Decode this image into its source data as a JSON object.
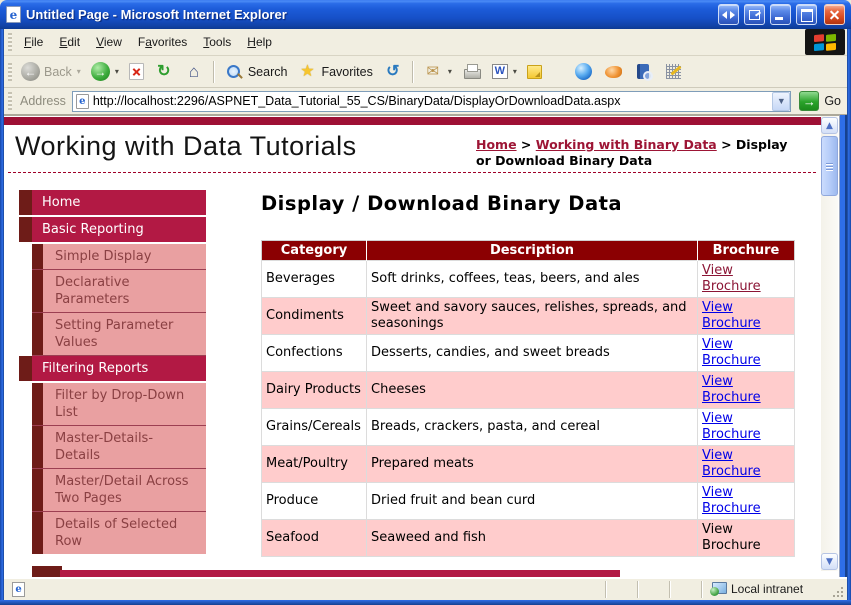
{
  "window": {
    "title": "Untitled Page - Microsoft Internet Explorer"
  },
  "menu_bar": {
    "items": [
      {
        "label": "File",
        "accel_index": 0
      },
      {
        "label": "Edit",
        "accel_index": 0
      },
      {
        "label": "View",
        "accel_index": 0
      },
      {
        "label": "Favorites",
        "accel_index": 1
      },
      {
        "label": "Tools",
        "accel_index": 0
      },
      {
        "label": "Help",
        "accel_index": 0
      }
    ]
  },
  "toolbar": {
    "buttons": [
      {
        "name": "back",
        "icon": "back",
        "label": "Back",
        "dropdown": true,
        "disabled": true
      },
      {
        "name": "forward",
        "icon": "forward",
        "dropdown": true
      },
      {
        "name": "stop",
        "icon": "stop"
      },
      {
        "name": "refresh",
        "icon": "refresh"
      },
      {
        "name": "home",
        "icon": "home"
      },
      {
        "type": "separator"
      },
      {
        "name": "search",
        "icon": "search",
        "label": "Search"
      },
      {
        "name": "favorites",
        "icon": "favorites",
        "label": "Favorites"
      },
      {
        "name": "history",
        "icon": "history"
      },
      {
        "type": "separator"
      },
      {
        "name": "mail",
        "icon": "mail",
        "dropdown": true
      },
      {
        "name": "print",
        "icon": "print"
      },
      {
        "name": "edit-with-word",
        "icon": "word",
        "dropdown": true
      },
      {
        "name": "discuss",
        "icon": "note"
      },
      {
        "type": "gap"
      },
      {
        "name": "messenger",
        "icon": "sphere"
      },
      {
        "name": "quick-link",
        "icon": "orange"
      },
      {
        "name": "research",
        "icon": "book"
      },
      {
        "name": "toolbar-extension",
        "icon": "grid"
      }
    ]
  },
  "address_bar": {
    "label": "Address",
    "url": "http://localhost:2296/ASPNET_Data_Tutorial_55_CS/BinaryData/DisplayOrDownloadData.aspx",
    "go_label": "Go"
  },
  "page": {
    "site_title": "Working with Data Tutorials",
    "breadcrumb": {
      "links": [
        "Home",
        "Working with Binary Data"
      ],
      "separator": ">",
      "current": "Display or Download Binary Data"
    },
    "sidebar": [
      {
        "label": "Home",
        "type": "top"
      },
      {
        "label": "Basic Reporting",
        "type": "top"
      },
      {
        "label": "Simple Display",
        "type": "sub"
      },
      {
        "label": "Declarative Parameters",
        "type": "sub"
      },
      {
        "label": "Setting Parameter Values",
        "type": "sub"
      },
      {
        "label": "Filtering Reports",
        "type": "top"
      },
      {
        "label": "Filter by Drop-Down List",
        "type": "sub"
      },
      {
        "label": "Master-Details-Details",
        "type": "sub"
      },
      {
        "label": "Master/Detail Across Two Pages",
        "type": "sub"
      },
      {
        "label": "Details of Selected Row",
        "type": "sub"
      }
    ],
    "heading": "Display / Download Binary Data",
    "table": {
      "columns": [
        "Category",
        "Description",
        "Brochure"
      ],
      "rows": [
        {
          "category": "Beverages",
          "description": "Soft drinks, coffees, teas, beers, and ales",
          "brochure": "View Brochure",
          "link_style": "visited"
        },
        {
          "category": "Condiments",
          "description": "Sweet and savory sauces, relishes, spreads, and seasonings",
          "brochure": "View Brochure",
          "link_style": "link"
        },
        {
          "category": "Confections",
          "description": "Desserts, candies, and sweet breads",
          "brochure": "View Brochure",
          "link_style": "link"
        },
        {
          "category": "Dairy Products",
          "description": "Cheeses",
          "brochure": "View Brochure",
          "link_style": "link"
        },
        {
          "category": "Grains/Cereals",
          "description": "Breads, crackers, pasta, and cereal",
          "brochure": "View Brochure",
          "link_style": "link"
        },
        {
          "category": "Meat/Poultry",
          "description": "Prepared meats",
          "brochure": "View Brochure",
          "link_style": "link"
        },
        {
          "category": "Produce",
          "description": "Dried fruit and bean curd",
          "brochure": "View Brochure",
          "link_style": "link"
        },
        {
          "category": "Seafood",
          "description": "Seaweed and fish",
          "brochure": "View Brochure",
          "link_style": "text"
        }
      ]
    }
  },
  "status_bar": {
    "zone": "Local intranet"
  },
  "colors": {
    "titlebar_blue": "#1c5bd8",
    "chrome_beige": "#ECE9D8",
    "menu_crimson": "#b21944",
    "menu_dark_maroon": "#6e1c18",
    "menu_sub_pink": "#e9a0a1",
    "menu_sub_text": "#8a4043",
    "table_header_maroon": "#8b0002",
    "row_pink": "#ffcccc",
    "link_blue": "#0000e8",
    "link_visited_maroon": "#8b1535",
    "breadcrumb_link": "#9d1535",
    "top_strip": "#9e1035"
  }
}
